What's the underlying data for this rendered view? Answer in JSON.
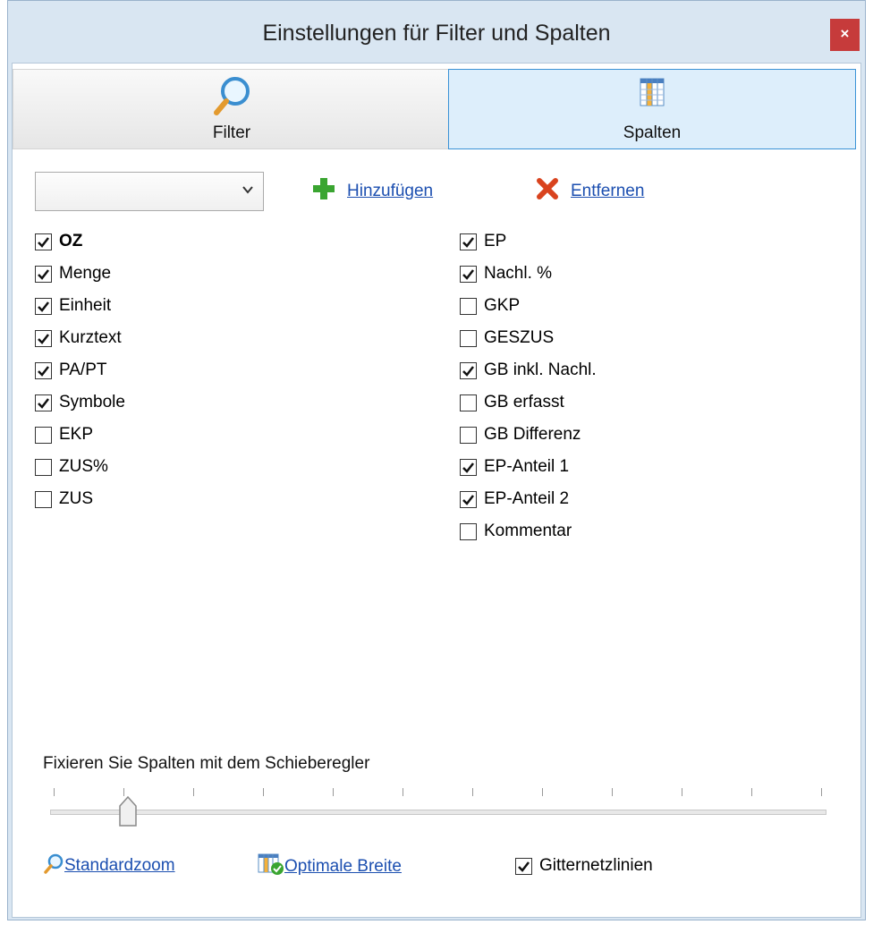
{
  "window": {
    "title": "Einstellungen für Filter und Spalten",
    "close_label": "×"
  },
  "tabs": [
    {
      "label": "Filter",
      "icon": "magnifier-icon",
      "selected": false
    },
    {
      "label": "Spalten",
      "icon": "columns-grid-icon",
      "selected": true
    }
  ],
  "toolbar": {
    "combo_value": "",
    "add_label": "Hinzufügen",
    "remove_label": "Entfernen"
  },
  "columns_left": [
    {
      "label": "OZ",
      "checked": true,
      "bold": true
    },
    {
      "label": "Menge",
      "checked": true
    },
    {
      "label": "Einheit",
      "checked": true
    },
    {
      "label": "Kurztext",
      "checked": true
    },
    {
      "label": "PA/PT",
      "checked": true
    },
    {
      "label": "Symbole",
      "checked": true
    },
    {
      "label": "EKP",
      "checked": false
    },
    {
      "label": "ZUS%",
      "checked": false
    },
    {
      "label": "ZUS",
      "checked": false
    }
  ],
  "columns_right": [
    {
      "label": "EP",
      "checked": true
    },
    {
      "label": "Nachl. %",
      "checked": true
    },
    {
      "label": "GKP",
      "checked": false
    },
    {
      "label": "GESZUS",
      "checked": false
    },
    {
      "label": "GB inkl. Nachl.",
      "checked": true
    },
    {
      "label": "GB erfasst",
      "checked": false
    },
    {
      "label": "GB Differenz",
      "checked": false
    },
    {
      "label": "EP-Anteil 1",
      "checked": true
    },
    {
      "label": "EP-Anteil 2",
      "checked": true
    },
    {
      "label": "Kommentar",
      "checked": false
    }
  ],
  "slider": {
    "label": "Fixieren Sie Spalten mit dem Schieberegler",
    "tick_count": 12,
    "value": 1
  },
  "bottom": {
    "zoom_label": "Standardzoom",
    "width_label": "Optimale Breite",
    "gridlines_label": "Gitternetzlinien",
    "gridlines_checked": true
  },
  "colors": {
    "accent": "#3a92d6",
    "link": "#1c4fb0",
    "close": "#c63b3b",
    "add": "#3aa531",
    "remove": "#d9431e"
  }
}
